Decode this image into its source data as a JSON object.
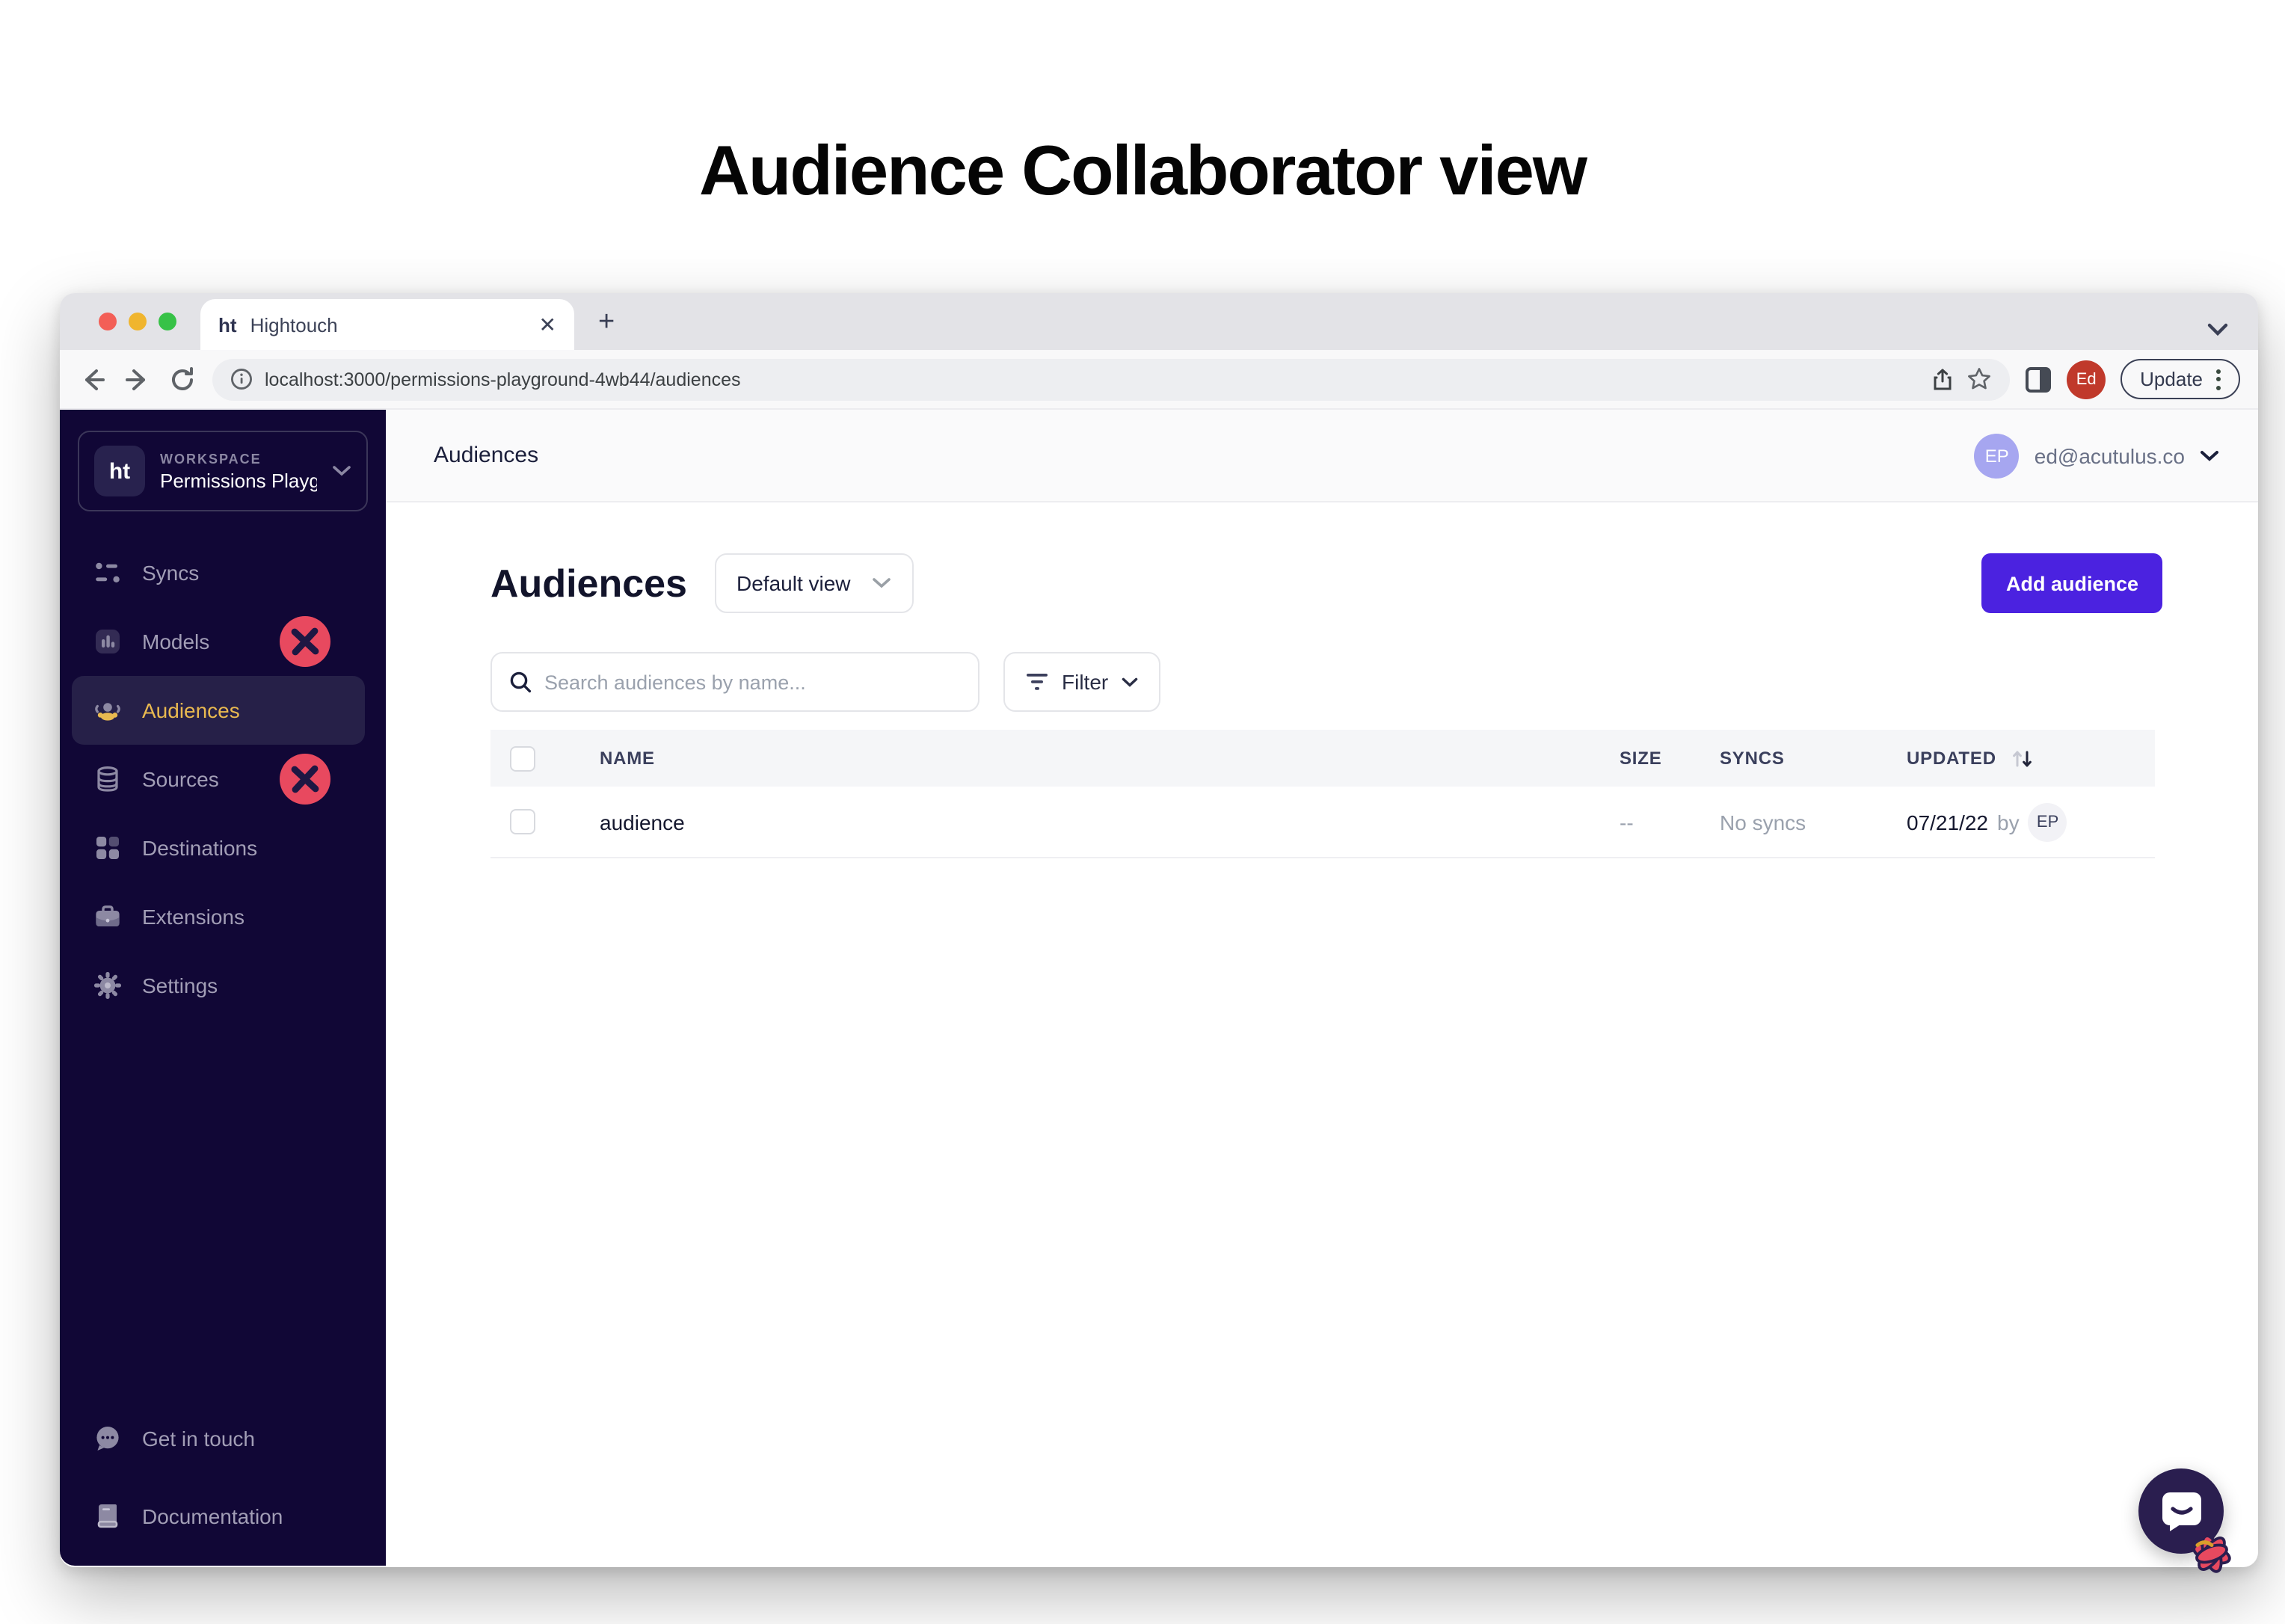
{
  "page": {
    "title": "Audience Collaborator view"
  },
  "browser": {
    "tab": {
      "favicon": "ht",
      "title": "Hightouch"
    },
    "url": "localhost:3000/permissions-playground-4wb44/audiences",
    "profile_initials": "Ed",
    "update_label": "Update"
  },
  "sidebar": {
    "workspace": {
      "logo": "ht",
      "label": "WORKSPACE",
      "name": "Permissions Playg..."
    },
    "items": [
      {
        "label": "Syncs"
      },
      {
        "label": "Models",
        "blocked": true
      },
      {
        "label": "Audiences",
        "selected": true
      },
      {
        "label": "Sources",
        "blocked": true
      },
      {
        "label": "Destinations"
      },
      {
        "label": "Extensions"
      },
      {
        "label": "Settings"
      }
    ],
    "footer": [
      {
        "label": "Get in touch"
      },
      {
        "label": "Documentation"
      }
    ]
  },
  "header": {
    "breadcrumb": "Audiences",
    "user_initials": "EP",
    "user_email": "ed@acutulus.co"
  },
  "main": {
    "heading": "Audiences",
    "view_selector": "Default view",
    "add_button": "Add audience",
    "search_placeholder": "Search audiences by name...",
    "filter_label": "Filter",
    "table": {
      "columns": {
        "name": "NAME",
        "size": "SIZE",
        "syncs": "SYNCS",
        "updated": "UPDATED"
      },
      "rows": [
        {
          "name": "audience",
          "size": "--",
          "syncs": "No syncs",
          "updated_date": "07/21/22",
          "updated_by_label": "by",
          "updated_by": "EP"
        }
      ]
    }
  },
  "colors": {
    "accent_purple": "#4B22E0",
    "sidebar_bg": "#110736",
    "sidebar_selected_bg": "#262048",
    "selected_amber": "#E9B950",
    "blocked_red": "#E8495F",
    "user_avatar_lavender": "#A6A6F0",
    "profile_avatar_red": "#C0392B"
  }
}
